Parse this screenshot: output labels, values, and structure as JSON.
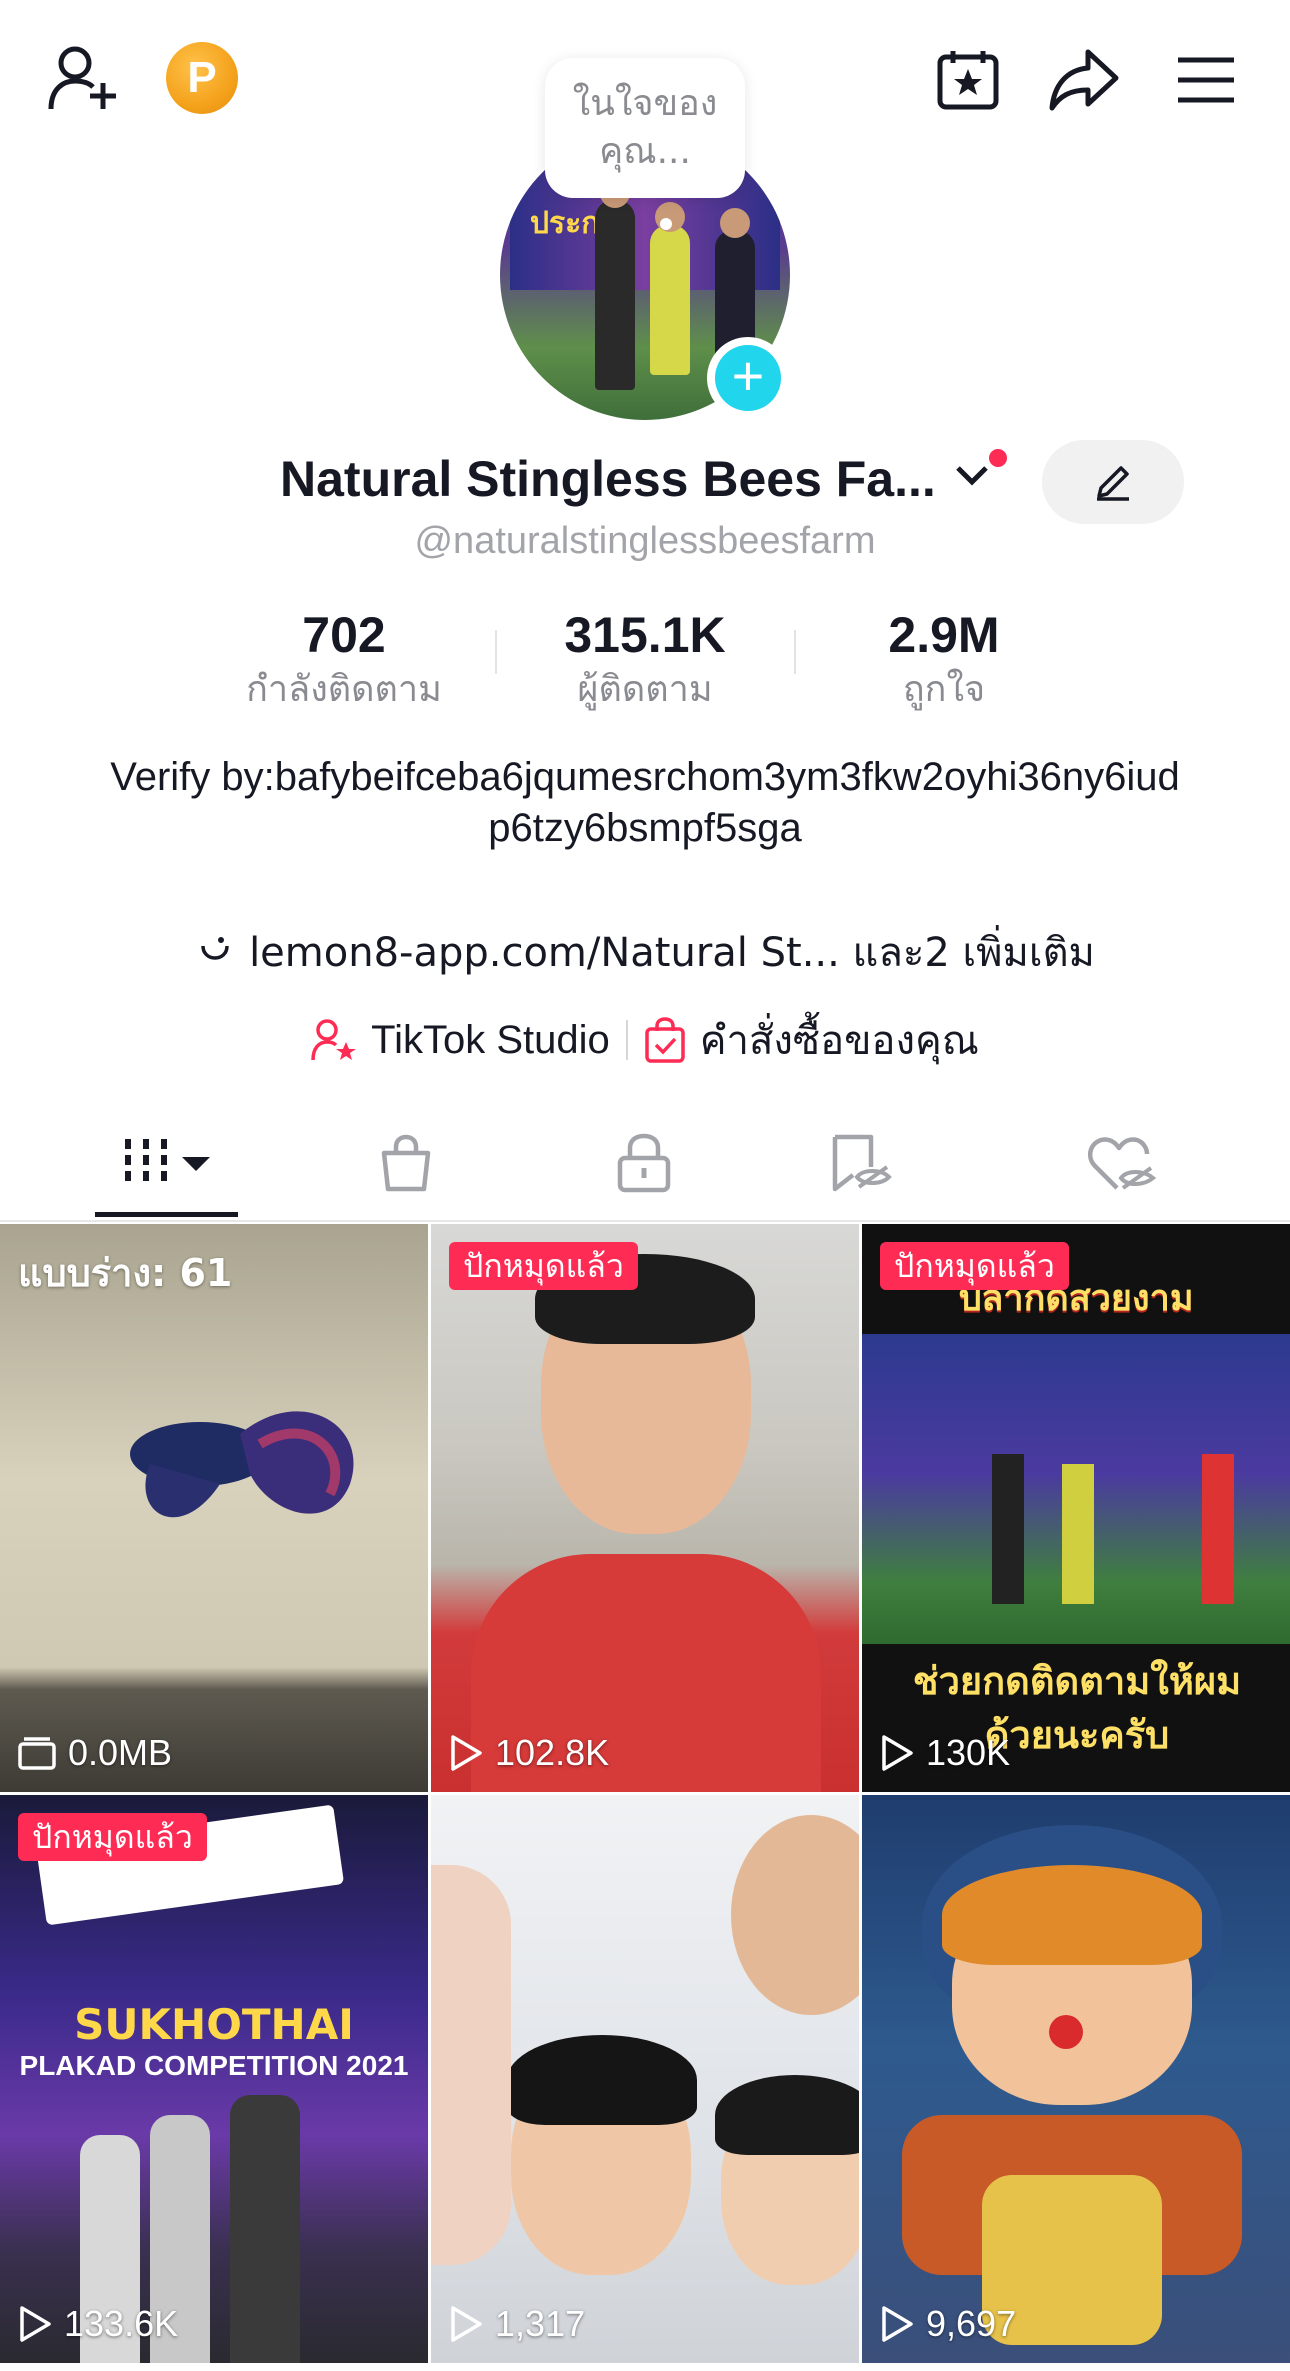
{
  "header": {
    "bubble_text": "ในใจของคุณ...",
    "coin_label": "P"
  },
  "profile": {
    "display_name": "Natural Stingless Bees Fa...",
    "handle": "@naturalstinglessbeesfarm",
    "stats": [
      {
        "value": "702",
        "label": "กำลังติดตาม"
      },
      {
        "value": "315.1K",
        "label": "ผู้ติดตาม"
      },
      {
        "value": "2.9M",
        "label": "ถูกใจ"
      }
    ],
    "bio": "Verify by:bafybeifceba6jqumesrchom3ym3fkw2oyhi36ny6iudp6tzy6bsmpf5sga",
    "link": "lemon8-app.com/Natural St... และ2 เพิ่มเติม",
    "chips": {
      "studio": "TikTok Studio",
      "orders": "คำสั่งซื้อของคุณ"
    }
  },
  "videos": [
    {
      "badge": "",
      "draft": "แบบร่าง: 61",
      "meta": "0.0MB",
      "meta_icon": "drafts-icon"
    },
    {
      "badge": "ปักหมุดแล้ว",
      "draft": "",
      "meta": "102.8K",
      "meta_icon": "play-icon"
    },
    {
      "badge": "ปักหมุดแล้ว",
      "draft": "",
      "meta": "130K",
      "meta_icon": "play-icon",
      "overlay_top": "ปลากัดสวยงาม",
      "overlay_bottom": "ช่วยกดติดตามให้ผมด้วยนะครับ"
    },
    {
      "badge": "ปักหมุดแล้ว",
      "draft": "",
      "meta": "133.6K",
      "meta_icon": "play-icon",
      "overlay_top": "SUKHOTHAI",
      "overlay_bottom": "PLAKAD COMPETITION 2021"
    },
    {
      "badge": "",
      "draft": "",
      "meta": "1,317",
      "meta_icon": "play-icon"
    },
    {
      "badge": "",
      "draft": "",
      "meta": "9,697",
      "meta_icon": "play-icon"
    }
  ],
  "colors": {
    "accent_red": "#fe2c55",
    "accent_cyan": "#20d5ec",
    "coin": "#f4a21c"
  }
}
